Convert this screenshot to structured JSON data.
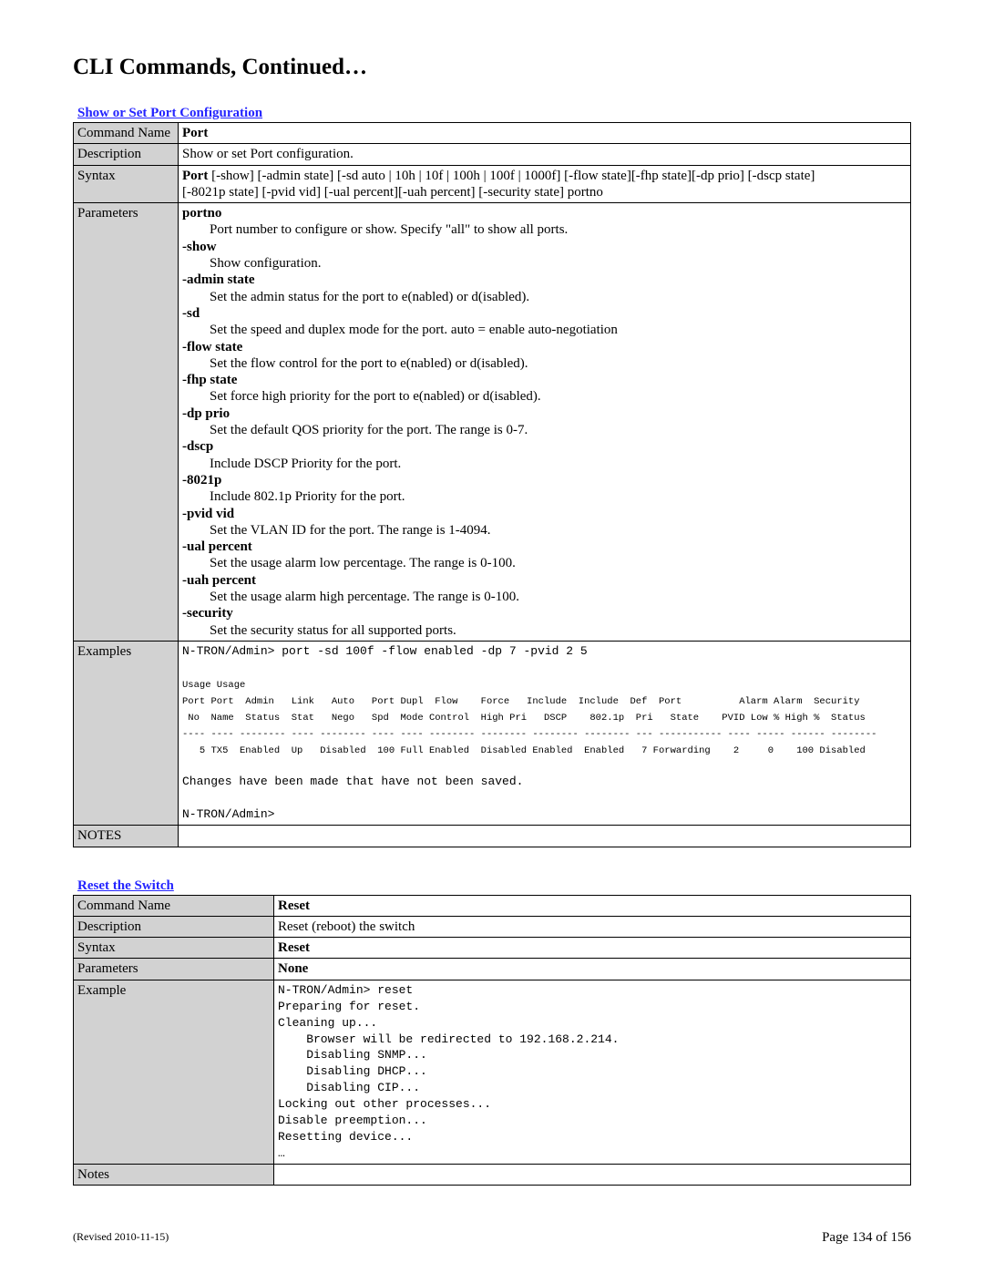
{
  "page": {
    "title": "CLI Commands, Continued…",
    "revised": "(Revised 2010-11-15)",
    "page_label": "Page 134 of 156"
  },
  "section1": {
    "heading": "Show or Set Port Configuration",
    "rows": {
      "command_name_label": "Command Name",
      "command_name_value": "Port",
      "description_label": "Description",
      "description_value": "Show or set Port configuration.",
      "syntax_label": "Syntax",
      "syntax_value_l1": "Port [-show] [-admin state] [-sd auto | 10h | 10f | 100h | 100f | 1000f] [-flow state][-fhp state][-dp prio] [-dscp state]",
      "syntax_value_l2": "       [-8021p state] [-pvid vid] [-ual percent][-uah percent] [-security state] portno",
      "parameters_label": "Parameters",
      "params": [
        {
          "name": "portno",
          "desc": "Port number to configure or show. Specify \"all\" to show all ports."
        },
        {
          "name": "-show",
          "desc": "Show configuration."
        },
        {
          "name": "-admin state",
          "desc": "Set the admin status for the port to e(nabled) or d(isabled)."
        },
        {
          "name": "-sd",
          "desc": "Set the speed and duplex mode for the port.  auto = enable auto-negotiation"
        },
        {
          "name": "-flow state",
          "desc": "Set the flow control for the port to e(nabled) or d(isabled)."
        },
        {
          "name": "-fhp state",
          "desc": "Set force high priority for the port to e(nabled) or d(isabled)."
        },
        {
          "name": "-dp prio",
          "desc": "Set the default QOS priority for the port. The range is 0-7."
        },
        {
          "name": "-dscp",
          "desc": "Include DSCP Priority for the port."
        },
        {
          "name": "-8021p",
          "desc": "Include 802.1p Priority for the port."
        },
        {
          "name": "-pvid vid",
          "desc": "Set the VLAN ID for the port. The range is 1-4094."
        },
        {
          "name": "-ual percent",
          "desc": "Set the usage alarm low percentage. The range is 0-100."
        },
        {
          "name": "-uah percent",
          "desc": "Set the usage alarm high percentage. The range is 0-100."
        },
        {
          "name": "-security",
          "desc": "Set the security status for all supported ports."
        }
      ],
      "examples_label": "Examples",
      "example_cmd": "N-TRON/Admin> port -sd 100f -flow enabled -dp 7 -pvid 2 5",
      "example_table_h1": "Usage Usage",
      "example_table_h2": "Port Port  Admin   Link   Auto   Port Dupl  Flow    Force   Include  Include  Def  Port          Alarm Alarm  Security",
      "example_table_h3": " No  Name  Status  Stat   Nego   Spd  Mode Control  High Pri   DSCP    802.1p  Pri   State    PVID Low % High %  Status",
      "example_table_h4": "---- ---- -------- ---- -------- ---- ---- -------- -------- -------- -------- --- ----------- ---- ----- ------ --------",
      "example_table_row": "   5 TX5  Enabled  Up   Disabled  100 Full Enabled  Disabled Enabled  Enabled   7 Forwarding    2     0    100 Disabled",
      "example_changes": "Changes have been made that have not been saved.",
      "example_prompt": "N-TRON/Admin>",
      "notes_label": "NOTES",
      "notes_value": ""
    }
  },
  "section2": {
    "heading": "Reset the Switch",
    "rows": {
      "command_name_label": "Command Name",
      "command_name_value": "Reset",
      "description_label": "Description",
      "description_value": "Reset (reboot) the switch",
      "syntax_label": "Syntax",
      "syntax_value": "Reset",
      "parameters_label": "Parameters",
      "parameters_value": "None",
      "example_label": "Example",
      "example_lines": "N-TRON/Admin> reset\nPreparing for reset.\nCleaning up...\n    Browser will be redirected to 192.168.2.214.\n    Disabling SNMP...\n    Disabling DHCP...\n    Disabling CIP...\nLocking out other processes...\nDisable preemption...\nResetting device...\n…",
      "notes_label": "Notes",
      "notes_value": ""
    }
  }
}
